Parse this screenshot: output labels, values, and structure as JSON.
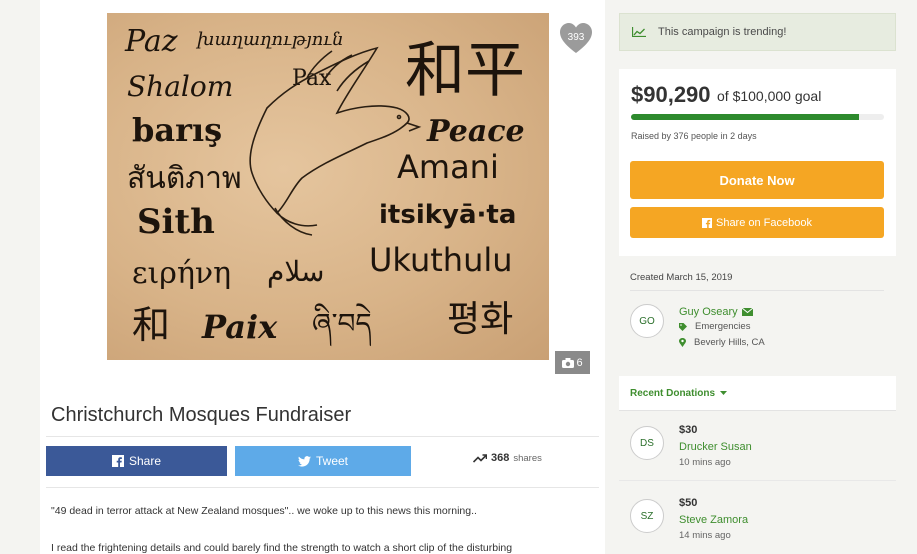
{
  "campaign": {
    "title": "Christchurch Mosques Fundraiser",
    "hearts": "393",
    "photo_count": "6"
  },
  "hero_words": {
    "row1": "Paz",
    "row1b": "խաղաղություն",
    "pax": "Pax",
    "shalom": "Shalom",
    "baris": "barış",
    "peace": "Peace",
    "thai": "สันติภาพ",
    "amani": "Amani",
    "sith": "Sith",
    "itsikya": "itsikyā·ta",
    "greek": "ειρήνη",
    "arabic": "سلام",
    "ukuthulu": "Ukuthulu",
    "wa": "和",
    "paix": "Paix",
    "tibetan": "ཞི་བདེ",
    "korean": "평화",
    "kanji": "和平"
  },
  "share": {
    "facebook_label": "Share",
    "twitter_label": "Tweet",
    "shares_count": "368",
    "shares_label": "shares"
  },
  "story": {
    "p1": "\"49 dead in terror attack at New Zealand mosques\".. we woke up to this news this morning..",
    "p2": "I read the frightening details and could barely find the strength to watch a short clip of the disturbing"
  },
  "sidebar": {
    "trending": "This campaign is trending!",
    "raised": "$90,290",
    "goal": "of $100,000 goal",
    "progress_fraction": 0.9029,
    "raised_by": "Raised by 376 people in 2 days",
    "donate_label": "Donate Now",
    "share_fb_label": "Share on Facebook",
    "created": "Created March 15, 2019",
    "organizer": {
      "initials": "GO",
      "name": "Guy Oseary",
      "category": "Emergencies",
      "location": "Beverly Hills, CA"
    },
    "recent_label": "Recent Donations",
    "donations": [
      {
        "initials": "DS",
        "amount": "$30",
        "name": "Drucker Susan",
        "time": "10 mins ago"
      },
      {
        "initials": "SZ",
        "amount": "$50",
        "name": "Steve Zamora",
        "time": "14 mins ago"
      }
    ]
  },
  "colors": {
    "accent_green": "#3f8e2f",
    "progress_green": "#2d8a2d",
    "donate_orange": "#f5a623",
    "facebook_blue": "#3b5998",
    "twitter_blue": "#5eaae8"
  }
}
